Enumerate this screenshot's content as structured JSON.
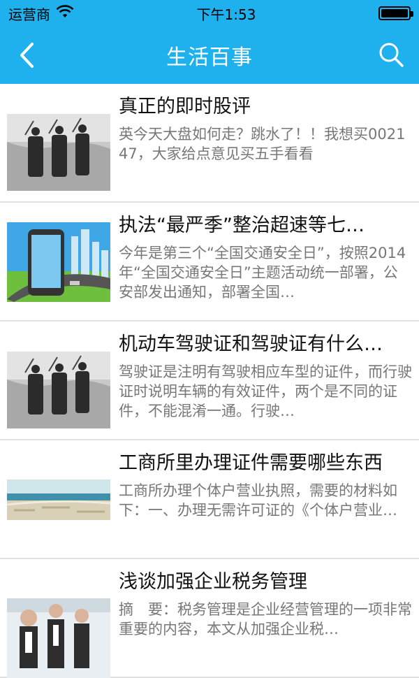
{
  "status_bar": {
    "carrier": "运营商",
    "time": "下午1:53"
  },
  "navbar": {
    "title": "生活百事",
    "back_icon": "chevron-left-icon",
    "search_icon": "search-icon"
  },
  "articles": [
    {
      "title": "真正的即时股评",
      "summary": "英今天大盘如何走？跳水了！！我想买002147，大家给点意见买五手看看"
    },
    {
      "title": "执法“最严季”整治超速等七…",
      "summary": "今年是第三个“全国交通安全日”，按照2014年“全国交通安全日”主题活动统一部署，公安部发出通知，部署全国…"
    },
    {
      "title": "机动车驾驶证和驾驶证有什么…",
      "summary": "驾驶证是注明有驾驶相应车型的证件，而行驶证时说明车辆的有效证件，两个是不同的证件，不能混淆一通。行驶…"
    },
    {
      "title": "工商所里办理证件需要哪些东西",
      "summary": "工商所办理个体户营业执照，需要的材料如下：一、办理无需许可证的《个体户营业…"
    },
    {
      "title": "浅谈加强企业税务管理",
      "summary": "摘　要：税务管理是企业经营管理的一项非常重要的内容，本文从加强企业税…"
    }
  ],
  "colors": {
    "accent": "#1fb0ee",
    "title_text": "#111111",
    "summary_text": "#777777"
  }
}
